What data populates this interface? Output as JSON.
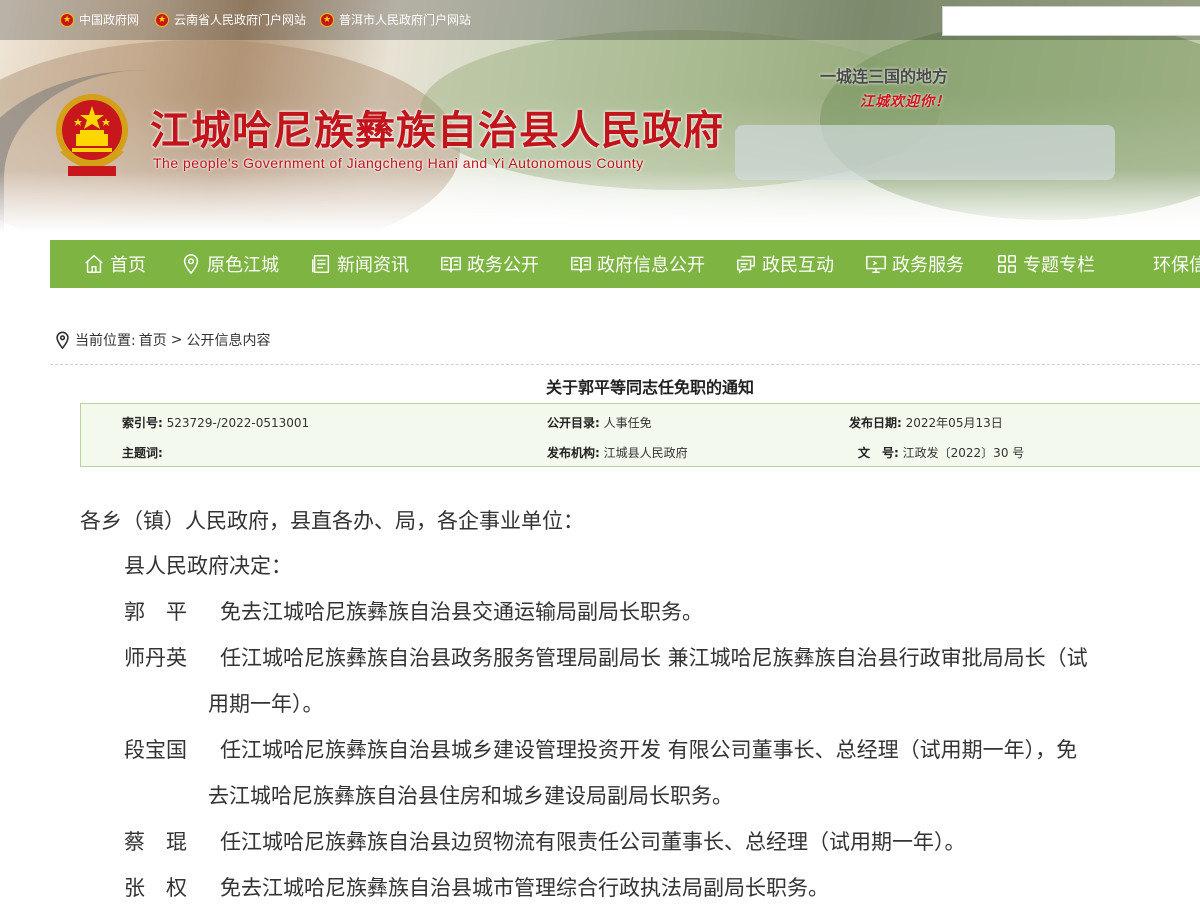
{
  "top_links": [
    {
      "label": "中国政府网"
    },
    {
      "label": "云南省人民政府门户网站"
    },
    {
      "label": "普洱市人民政府门户网站"
    }
  ],
  "header": {
    "title": "江城哈尼族彝族自治县人民政府",
    "subtitle": "The people's Government of Jiangcheng Hani and Yi Autonomous County",
    "slogan": "一城连三国的地方",
    "slogan2": "江城欢迎你！"
  },
  "nav": [
    {
      "label": "首页",
      "icon": "home-icon"
    },
    {
      "label": "原色江城",
      "icon": "location-pin-icon"
    },
    {
      "label": "新闻资讯",
      "icon": "news-icon"
    },
    {
      "label": "政务公开",
      "icon": "open-book-icon"
    },
    {
      "label": "政府信息公开",
      "icon": "book-icon"
    },
    {
      "label": "政民互动",
      "icon": "chat-icon"
    },
    {
      "label": "政务服务",
      "icon": "monitor-icon"
    },
    {
      "label": "专题专栏",
      "icon": "grid-icon"
    },
    {
      "label": "环保信"
    }
  ],
  "breadcrumb": {
    "label": "当前位置:",
    "home": "首页",
    "separator": ">",
    "current": "公开信息内容"
  },
  "article": {
    "title": "关于郭平等同志任免职的通知",
    "meta": {
      "index_key": "索引号:",
      "index_value": "523729-/2022-0513001",
      "catalog_key": "公开目录:",
      "catalog_value": "人事任免",
      "date_key": "发布日期:",
      "date_value": "2022年05月13日",
      "subject_key": "主题词:",
      "subject_value": "",
      "org_key": "发布机构:",
      "org_value": "江城县人民政府",
      "docno_key": "文　号:",
      "docno_value": "江政发〔2022〕30 号"
    },
    "salutation": "各乡（镇）人民政府，县直各办、局，各企事业单位：",
    "decision": "县人民政府决定：",
    "entries": [
      {
        "name": "郭　平",
        "text": "免去江城哈尼族彝族自治县交通运输局副局长职务。"
      },
      {
        "name": "师丹英",
        "text": "任江城哈尼族彝族自治县政务服务管理局副局长  兼江城哈尼族彝族自治县行政审批局局长（试",
        "cont": "用期一年）。"
      },
      {
        "name": "段宝国",
        "text": "任江城哈尼族彝族自治县城乡建设管理投资开发  有限公司董事长、总经理（试用期一年），免",
        "cont": "去江城哈尼族彝族自治县住房和城乡建设局副局长职务。"
      },
      {
        "name": "蔡　琨",
        "text": "任江城哈尼族彝族自治县边贸物流有限责任公司董事长、总经理（试用期一年）。"
      },
      {
        "name": "张　权",
        "text": "免去江城哈尼族彝族自治县城市管理综合行政执法局副局长职务。"
      }
    ]
  }
}
